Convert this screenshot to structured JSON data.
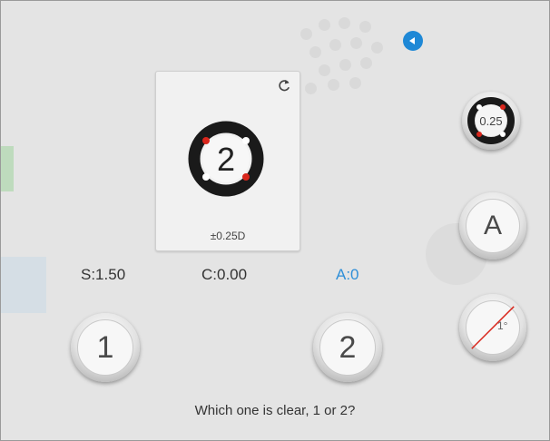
{
  "controls": {
    "back_icon": "back-arrow-icon",
    "refresh_icon": "refresh-icon",
    "small_ring_value": "0.25"
  },
  "card": {
    "number": "2",
    "diopter": "±0.25D"
  },
  "values": {
    "sphere": "S:1.50",
    "cylinder": "C:0.00",
    "axis": "A:0"
  },
  "buttons": {
    "option1": "1",
    "option2": "2",
    "axis_mode": "A",
    "degree": "1°"
  },
  "question": "Which one is clear, 1 or 2?",
  "colors": {
    "accent": "#2f8fd8",
    "ring": "#1a1a1a",
    "marker_red": "#d9261c",
    "marker_white": "#ffffff"
  }
}
